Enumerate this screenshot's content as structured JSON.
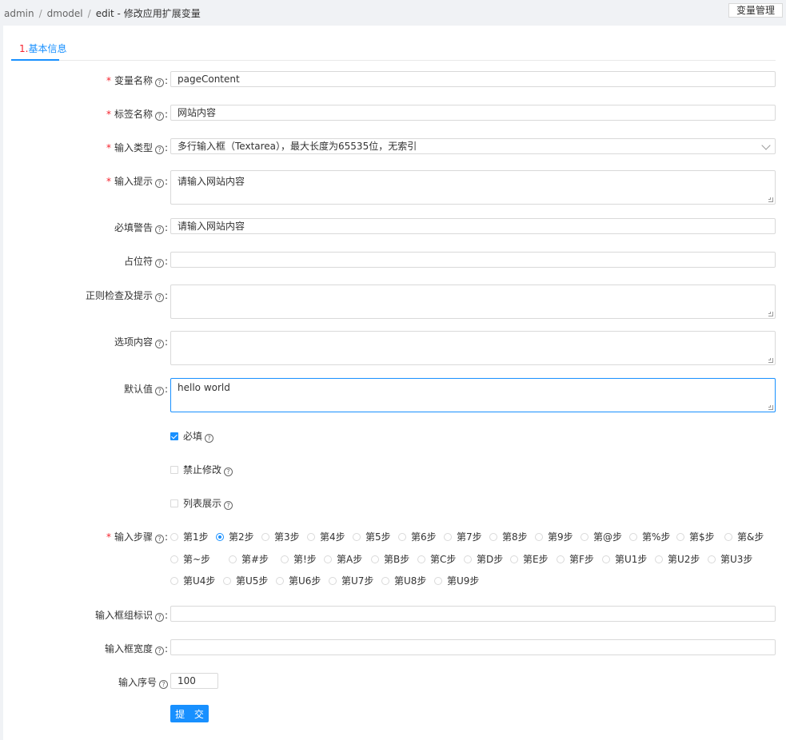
{
  "breadcrumb": {
    "items": [
      "admin",
      "dmodel",
      "edit"
    ],
    "separator": "/",
    "title": "修改应用扩展变量"
  },
  "header": {
    "var_manage_label": "变量管理"
  },
  "tabs": [
    {
      "num": "1.",
      "label": "基本信息"
    }
  ],
  "form": {
    "var_name": {
      "label": "变量名称",
      "value": "pageContent",
      "required": true
    },
    "tag_name": {
      "label": "标签名称",
      "value": "网站内容",
      "required": true
    },
    "input_type": {
      "label": "输入类型",
      "value": "多行输入框（Textarea），最大长度为65535位，无索引",
      "required": true
    },
    "input_hint": {
      "label": "输入提示",
      "value": "请输入网站内容",
      "required": true
    },
    "required_warning": {
      "label": "必填警告",
      "value": "请输入网站内容"
    },
    "placeholder": {
      "label": "占位符",
      "value": ""
    },
    "regex": {
      "label": "正则检查及提示",
      "value": ""
    },
    "options": {
      "label": "选项内容",
      "value": ""
    },
    "default_value": {
      "label": "默认值",
      "value": "hello world"
    },
    "chk_required": {
      "label": "必填",
      "checked": true
    },
    "chk_readonly": {
      "label": "禁止修改",
      "checked": false
    },
    "chk_list": {
      "label": "列表展示",
      "checked": false
    },
    "input_step": {
      "label": "输入步骤",
      "required": true,
      "selected": "第2步",
      "options": [
        "第1步",
        "第2步",
        "第3步",
        "第4步",
        "第5步",
        "第6步",
        "第7步",
        "第8步",
        "第9步",
        "第@步",
        "第%步",
        "第$步",
        "第&步",
        "第~步",
        "第#步",
        "第!步",
        "第A步",
        "第B步",
        "第C步",
        "第D步",
        "第E步",
        "第F步",
        "第U1步",
        "第U2步",
        "第U3步",
        "第U4步",
        "第U5步",
        "第U6步",
        "第U7步",
        "第U8步",
        "第U9步"
      ]
    },
    "group_id": {
      "label": "输入框组标识",
      "value": ""
    },
    "width": {
      "label": "输入框宽度",
      "value": ""
    },
    "order": {
      "label": "输入序号",
      "value": "100"
    },
    "submit_label": "提 交"
  }
}
